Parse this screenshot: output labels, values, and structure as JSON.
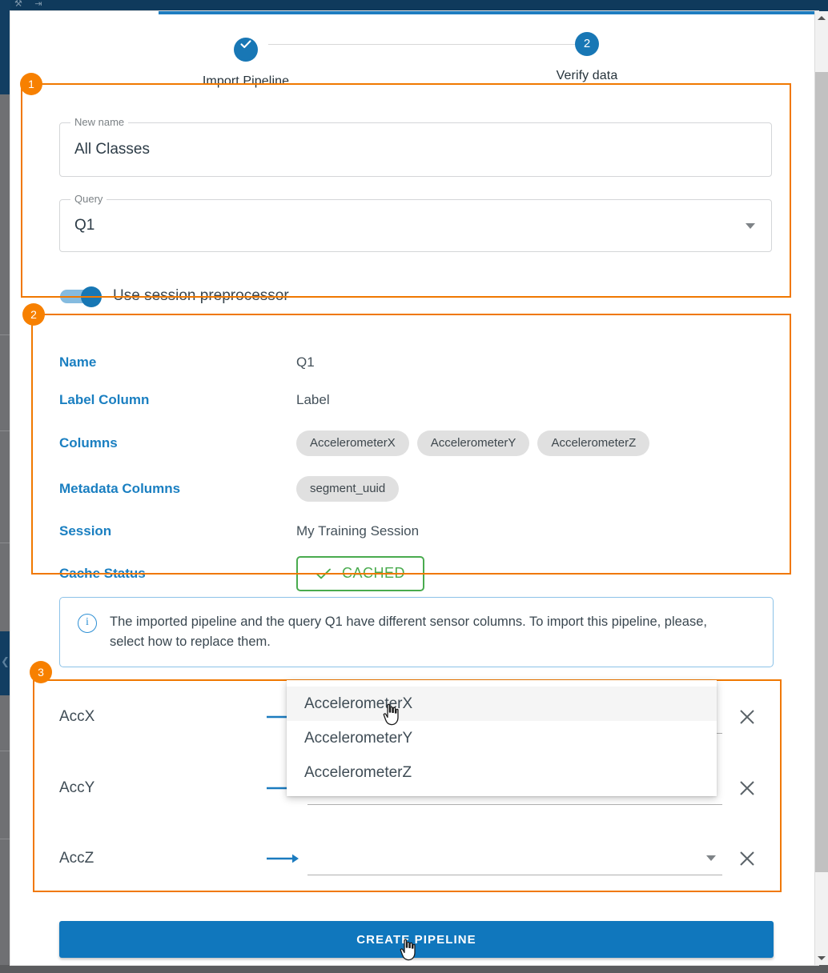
{
  "window": {
    "title_icons": "⚒ ⇥"
  },
  "stepper": {
    "steps": [
      {
        "label": "Import Pipeline",
        "marker": "check-icon",
        "state": "completed"
      },
      {
        "label": "Verify data",
        "marker": "2",
        "state": "active"
      }
    ],
    "accent_color": "#1877b5"
  },
  "annotations": {
    "color": "#f07800",
    "badges": [
      "1",
      "2",
      "3"
    ]
  },
  "form": {
    "new_name": {
      "label": "New name",
      "value": "All Classes"
    },
    "query": {
      "label": "Query",
      "value": "Q1",
      "options": [
        "Q1"
      ]
    },
    "session_preprocessor": {
      "label": "Use session preprocessor",
      "enabled": true
    }
  },
  "details": {
    "rows": [
      {
        "key": "Name",
        "type": "text",
        "value": "Q1"
      },
      {
        "key": "Label Column",
        "type": "text",
        "value": "Label"
      },
      {
        "key": "Columns",
        "type": "chips",
        "chips": [
          "AccelerometerX",
          "AccelerometerY",
          "AccelerometerZ"
        ]
      },
      {
        "key": "Metadata Columns",
        "type": "chips",
        "chips": [
          "segment_uuid"
        ]
      },
      {
        "key": "Session",
        "type": "text",
        "value": "My Training Session"
      },
      {
        "key": "Cache Status",
        "type": "badge",
        "value": "CACHED",
        "badge_color": "#49ab4e"
      }
    ],
    "key_color": "#1a7fc1"
  },
  "info_banner": {
    "icon": "info-icon",
    "text": "The imported pipeline and the query Q1 have different sensor columns. To import this pipeline, please, select how to replace them."
  },
  "mapping": {
    "rows": [
      {
        "source": "AccX",
        "target": "",
        "target_placeholder": ""
      },
      {
        "source": "AccY",
        "target": "",
        "target_placeholder": ""
      },
      {
        "source": "AccZ",
        "target": "",
        "target_placeholder": ""
      }
    ],
    "arrow_icon": "arrow-right-icon",
    "remove_icon": "close-icon"
  },
  "dropdown": {
    "open_for_row": 0,
    "options": [
      "AccelerometerX",
      "AccelerometerY",
      "AccelerometerZ"
    ],
    "highlighted_index": 0
  },
  "footer": {
    "create_label": "CREATE PIPELINE",
    "button_color": "#1077bd"
  },
  "scrollbar": {
    "up_icon": "chevron-up-icon",
    "down_icon": "chevron-down-icon"
  }
}
